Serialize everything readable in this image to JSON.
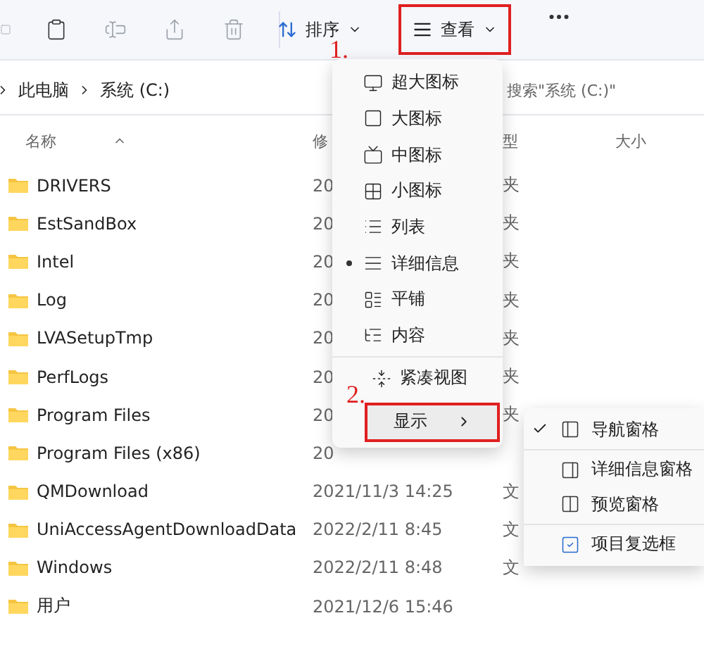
{
  "toolbar": {
    "sort": {
      "label": "排序"
    },
    "view": {
      "label": "查看"
    }
  },
  "address": {
    "path": [
      "此电脑",
      "系统 (C:)"
    ],
    "search": {
      "placeholder": "搜索\"系统 (C:)\""
    }
  },
  "table": {
    "columns": [
      "名称",
      "修",
      "型",
      "大小"
    ],
    "rows": [
      {
        "name": "DRIVERS",
        "modified": "20",
        "type": "夹"
      },
      {
        "name": "EstSandBox",
        "modified": "20",
        "type": "夹"
      },
      {
        "name": "Intel",
        "modified": "20",
        "type": "夹"
      },
      {
        "name": "Log",
        "modified": "20",
        "type": "夹"
      },
      {
        "name": "LVASetupTmp",
        "modified": "20",
        "type": "夹"
      },
      {
        "name": "PerfLogs",
        "modified": "20",
        "type": "夹"
      },
      {
        "name": "Program Files",
        "modified": "20",
        "type": "夹"
      },
      {
        "name": "Program Files (x86)",
        "modified": "20"
      },
      {
        "name": "QMDownload",
        "modified": "2021/11/3 14:25",
        "type": "文"
      },
      {
        "name": "UniAccessAgentDownloadData",
        "modified": "2022/2/11 8:45",
        "type": "文"
      },
      {
        "name": "Windows",
        "modified": "2022/2/11 8:48",
        "type": "文"
      },
      {
        "name": "用户",
        "modified": "2021/12/6 15:46"
      }
    ]
  },
  "view_menu": {
    "items": [
      {
        "label": "超大图标",
        "kind": "xlarge",
        "selected": false
      },
      {
        "label": "大图标",
        "kind": "large",
        "selected": false
      },
      {
        "label": "中图标",
        "kind": "medium",
        "selected": false
      },
      {
        "label": "小图标",
        "kind": "small",
        "selected": false
      },
      {
        "label": "列表",
        "kind": "list",
        "selected": false
      },
      {
        "label": "详细信息",
        "kind": "details",
        "selected": true
      },
      {
        "label": "平铺",
        "kind": "tiles",
        "selected": false
      },
      {
        "label": "内容",
        "kind": "content",
        "selected": false
      },
      {
        "label": "紧凑视图",
        "kind": "compact",
        "selected": false
      }
    ],
    "show": {
      "label": "显示"
    }
  },
  "show_submenu": {
    "items": [
      {
        "label": "导航窗格",
        "kind": "nav",
        "checked": true
      },
      {
        "label": "详细信息窗格",
        "kind": "details",
        "checked": false
      },
      {
        "label": "预览窗格",
        "kind": "preview",
        "checked": false
      },
      {
        "label": "项目复选框",
        "kind": "checkbox",
        "checked": false
      }
    ]
  },
  "annotations": [
    {
      "label": "1."
    },
    {
      "label": "2."
    }
  ]
}
